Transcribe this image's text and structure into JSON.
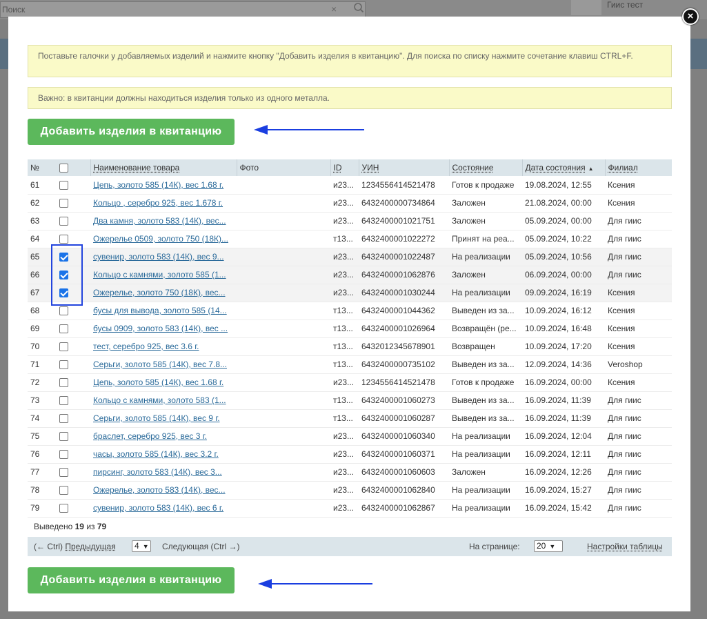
{
  "background": {
    "search_placeholder": "Поиск",
    "user_name": "Гиис тест"
  },
  "notices": {
    "instructions": "Поставьте галочки у добавляемых изделий и нажмите кнопку \"Добавить изделия в квитанцию\". Для поиска по списку нажмите сочетание клавиш CTRL+F.",
    "warning": "Важно: в квитанции должны находиться изделия только из одного металла."
  },
  "add_button_label": "Добавить изделия в квитанцию",
  "table": {
    "headers": {
      "num": "№",
      "name": "Наименование товара",
      "photo": "Фото",
      "id": "ID",
      "uin": "УИН",
      "state": "Состояние",
      "state_date": "Дата состояния",
      "branch": "Филиал"
    },
    "rows": [
      {
        "num": "61",
        "checked": false,
        "name": "Цепь, золото 585 (14К), вес 1.68 г.",
        "id": "и23...",
        "uin": "1234556414521478",
        "state": "Готов к продаже",
        "date": "19.08.2024, 12:55",
        "branch": "Ксения"
      },
      {
        "num": "62",
        "checked": false,
        "name": "Кольцо , серебро 925, вес 1.678 г.",
        "id": "и23...",
        "uin": "6432400000734864",
        "state": "Заложен",
        "date": "21.08.2024, 00:00",
        "branch": "Ксения"
      },
      {
        "num": "63",
        "checked": false,
        "name": "Два камня, золото 583 (14К), вес...",
        "id": "и23...",
        "uin": "6432400001021751",
        "state": "Заложен",
        "date": "05.09.2024, 00:00",
        "branch": "Для гиис"
      },
      {
        "num": "64",
        "checked": false,
        "name": "Ожерелье 0509, золото 750 (18К)...",
        "id": "т13...",
        "uin": "6432400001022272",
        "state": "Принят на реа...",
        "date": "05.09.2024, 10:22",
        "branch": "Для гиис"
      },
      {
        "num": "65",
        "checked": true,
        "name": "сувенир, золото 583 (14К), вес 9...",
        "id": "и23...",
        "uin": "6432400001022487",
        "state": "На реализации",
        "date": "05.09.2024, 10:56",
        "branch": "Для гиис"
      },
      {
        "num": "66",
        "checked": true,
        "name": "Кольцо с камнями, золото 585 (1...",
        "id": "и23...",
        "uin": "6432400001062876",
        "state": "Заложен",
        "date": "06.09.2024, 00:00",
        "branch": "Для гиис"
      },
      {
        "num": "67",
        "checked": true,
        "name": "Ожерелье, золото 750 (18К), вес...",
        "id": "и23...",
        "uin": "6432400001030244",
        "state": "На реализации",
        "date": "09.09.2024, 16:19",
        "branch": "Ксения"
      },
      {
        "num": "68",
        "checked": false,
        "name": "бусы для вывода, золото 585 (14...",
        "id": "т13...",
        "uin": "6432400001044362",
        "state": "Выведен из за...",
        "date": "10.09.2024, 16:12",
        "branch": "Ксения"
      },
      {
        "num": "69",
        "checked": false,
        "name": "бусы 0909, золото 583 (14К), вес ...",
        "id": "т13...",
        "uin": "6432400001026964",
        "state": "Возвращён (ре...",
        "date": "10.09.2024, 16:48",
        "branch": "Ксения"
      },
      {
        "num": "70",
        "checked": false,
        "name": "тест, серебро 925, вес 3.6 г.",
        "id": "т13...",
        "uin": "6432012345678901",
        "state": "Возвращен",
        "date": "10.09.2024, 17:20",
        "branch": "Ксения"
      },
      {
        "num": "71",
        "checked": false,
        "name": "Серьги, золото 585 (14К), вес 7.8...",
        "id": "т13...",
        "uin": "6432400000735102",
        "state": "Выведен из за...",
        "date": "12.09.2024, 14:36",
        "branch": "Veroshop"
      },
      {
        "num": "72",
        "checked": false,
        "name": "Цепь, золото 585 (14К), вес 1.68 г.",
        "id": "и23...",
        "uin": "1234556414521478",
        "state": "Готов к продаже",
        "date": "16.09.2024, 00:00",
        "branch": "Ксения"
      },
      {
        "num": "73",
        "checked": false,
        "name": "Кольцо с камнями, золото 583 (1...",
        "id": "т13...",
        "uin": "6432400001060273",
        "state": "Выведен из за...",
        "date": "16.09.2024, 11:39",
        "branch": "Для гиис"
      },
      {
        "num": "74",
        "checked": false,
        "name": "Серьги, золото 585 (14К), вес 9 г.",
        "id": "т13...",
        "uin": "6432400001060287",
        "state": "Выведен из за...",
        "date": "16.09.2024, 11:39",
        "branch": "Для гиис"
      },
      {
        "num": "75",
        "checked": false,
        "name": "браслет, серебро 925, вес 3 г.",
        "id": "и23...",
        "uin": "6432400001060340",
        "state": "На реализации",
        "date": "16.09.2024, 12:04",
        "branch": "Для гиис"
      },
      {
        "num": "76",
        "checked": false,
        "name": "часы, золото 585 (14К), вес 3.2 г.",
        "id": "и23...",
        "uin": "6432400001060371",
        "state": "На реализации",
        "date": "16.09.2024, 12:11",
        "branch": "Для гиис"
      },
      {
        "num": "77",
        "checked": false,
        "name": "пирсинг, золото 583 (14К), вес 3...",
        "id": "и23...",
        "uin": "6432400001060603",
        "state": "Заложен",
        "date": "16.09.2024, 12:26",
        "branch": "Для гиис"
      },
      {
        "num": "78",
        "checked": false,
        "name": "Ожерелье, золото 583 (14К), вес...",
        "id": "и23...",
        "uin": "6432400001062840",
        "state": "На реализации",
        "date": "16.09.2024, 15:27",
        "branch": "Для гиис"
      },
      {
        "num": "79",
        "checked": false,
        "name": "сувенир, золото 583 (14К), вес 6 г.",
        "id": "и23...",
        "uin": "6432400001062867",
        "state": "На реализации",
        "date": "16.09.2024, 15:42",
        "branch": "Для гиис"
      }
    ]
  },
  "summary": {
    "prefix": "Выведено",
    "shown": "19",
    "of": "из",
    "total": "79"
  },
  "pager": {
    "prev_hint": "(← Ctrl)",
    "prev_label": "Предыдущая",
    "page_value": "4",
    "next_label": "Следующая (Ctrl →)",
    "per_page_label": "На странице:",
    "per_page_value": "20",
    "settings_label": "Настройки таблицы"
  },
  "colors": {
    "add_button": "#5cb85c",
    "annotation_blue": "#1a3ee0",
    "notice_bg": "#fafac8",
    "header_bg": "#dbe5ea"
  }
}
